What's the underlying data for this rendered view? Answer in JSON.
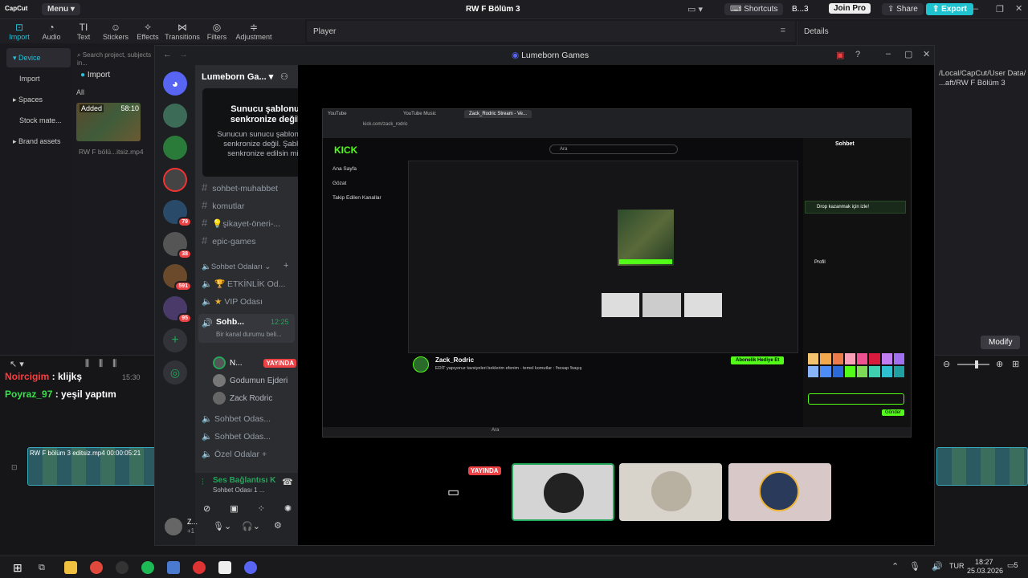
{
  "capcut": {
    "logo": "CapCut",
    "menu": "Menu",
    "project_title": "RW F Bölüm 3",
    "shortcuts": "Shortcuts",
    "user_short": "B...3",
    "join_pro": "Join Pro",
    "share": "Share",
    "export": "Export",
    "tools": [
      "Import",
      "Audio",
      "Text",
      "Stickers",
      "Effects",
      "Transitions",
      "Filters",
      "Adjustment"
    ],
    "player_label": "Player",
    "details_label": "Details",
    "details_path": "/Local/CapCut/User Data/ ...aft/RW F Bölüm 3",
    "nav": [
      "Device",
      "Import",
      "Spaces",
      "Stock mate...",
      "Brand assets"
    ],
    "search_placeholder": "Search project, subjects in...",
    "import_btn": "Import",
    "filter_all": "All",
    "clip_added": "Added",
    "clip_duration": "58:10",
    "clip_name": "RW F bölü...itsiz.mp4",
    "modify": "Modify",
    "timeline_clip": "RW F bölüm 3 editsiz.mp4  00:00:05:21",
    "timeline_clip2": "RW F",
    "time_mark": "15:30"
  },
  "chat_overlay": [
    {
      "user": "Noircigim",
      "text": " : klijkş",
      "color": "#ff3b3b"
    },
    {
      "user": "Poyraz_97",
      "text": " : yeşil yaptım",
      "color": "#37e04a"
    }
  ],
  "discord": {
    "window_title": "Lumeborn Games",
    "server_name": "Lumeborn Ga...",
    "badges": [
      "79",
      "38",
      "591",
      "95"
    ],
    "popup": {
      "title": "Sunucu şablonu senkronize değil",
      "body": "Sunucun sunucu şablonunla senkronize değil. Şablon senkronize edilsin mi?"
    },
    "text_channels": [
      "sohbet-muhabbet",
      "komutlar",
      "💡şikayet-öneri-...",
      "epic-games"
    ],
    "voice_category": "Sohbet Odaları",
    "voice_channels": [
      {
        "name": "ETKİNLİK Od...",
        "icon": "🏆"
      },
      {
        "name": "VIP Odası",
        "icon": "★"
      }
    ],
    "active_channel": {
      "name": "Sohb...",
      "time": "12:25",
      "status": "Bir kanal durumu beli..."
    },
    "members": [
      {
        "name": "N...",
        "live": "YAYINDA"
      },
      {
        "name": "Godumun Ejderi",
        "live": ""
      },
      {
        "name": "Zack Rodric",
        "live": ""
      }
    ],
    "more_voice": [
      "Sohbet Odas...",
      "Sohbet Odas...",
      "Özel Odalar +"
    ],
    "voice_connected": "Ses Bağlantısı K",
    "voice_sub": "Sohbet Odası 1 ...",
    "user_name": "Z...",
    "user_extra": "+1",
    "tile_live": "YAYINDA"
  },
  "stream": {
    "browser_tabs": [
      "YouTube",
      "YouTube Music",
      "Zack_Rodric Stream - Ve..."
    ],
    "url": "kick.com/zack_rodric",
    "search": "Ara",
    "nav": [
      "Ana Sayfa",
      "Gözat",
      "Takip Edilen Kanallar"
    ],
    "streamer": "Zack_Rodric",
    "stream_title": "EDİT yapıyoruz tavsiyeleri beklerim efenim - temel komutlar : !hesap !başış",
    "follow": "Abonelik Hediye Et",
    "chat_title": "Sohbet",
    "drop": "Drop kazanmak için izle!",
    "profile": "Profil",
    "send": "Gönder",
    "taskbar_search": "Ara"
  },
  "taskbar": {
    "lang": "TUR",
    "time": "18:27",
    "date": "25.03.2026",
    "notif": "5"
  }
}
